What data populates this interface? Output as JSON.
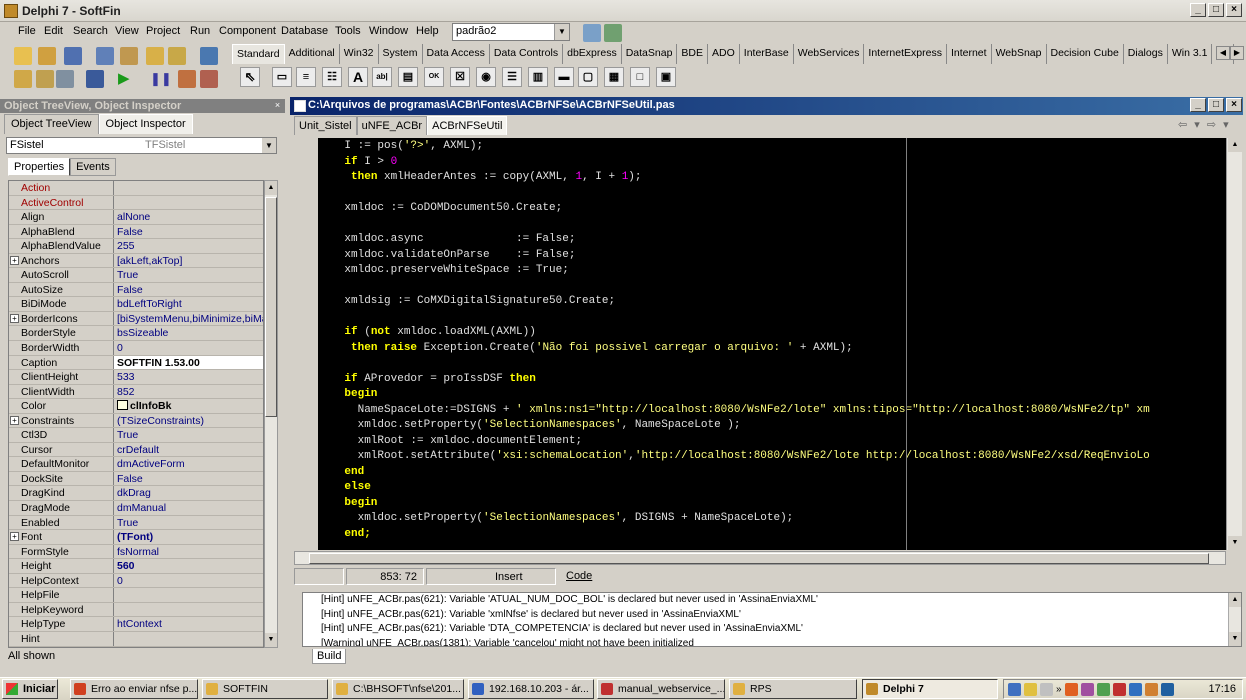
{
  "window": {
    "title": "Delphi 7 - SoftFin"
  },
  "menu": [
    "File",
    "Edit",
    "Search",
    "View",
    "Project",
    "Run",
    "Component",
    "Database",
    "Tools",
    "Window",
    "Help"
  ],
  "desktop_combo": "padrão2",
  "palette_tabs": [
    "Standard",
    "Additional",
    "Win32",
    "System",
    "Data Access",
    "Data Controls",
    "dbExpress",
    "DataSnap",
    "BDE",
    "ADO",
    "InterBase",
    "WebServices",
    "InternetExpress",
    "Internet",
    "WebSnap",
    "Decision Cube",
    "Dialogs",
    "Win 3.1",
    "Sa"
  ],
  "left_panel": {
    "title": "Object TreeView, Object Inspector",
    "tabs": [
      "Object TreeView",
      "Object Inspector"
    ],
    "object_name": "FSistel",
    "object_type": "TFSistel",
    "prop_tabs": [
      "Properties",
      "Events"
    ],
    "properties": [
      {
        "name": "Action",
        "value": "",
        "red": true
      },
      {
        "name": "ActiveControl",
        "value": "",
        "red": true
      },
      {
        "name": "Align",
        "value": "alNone"
      },
      {
        "name": "AlphaBlend",
        "value": "False"
      },
      {
        "name": "AlphaBlendValue",
        "value": "255"
      },
      {
        "name": "Anchors",
        "value": "[akLeft,akTop]",
        "plus": true
      },
      {
        "name": "AutoScroll",
        "value": "True"
      },
      {
        "name": "AutoSize",
        "value": "False"
      },
      {
        "name": "BiDiMode",
        "value": "bdLeftToRight"
      },
      {
        "name": "BorderIcons",
        "value": "[biSystemMenu,biMinimize,biMaxim",
        "plus": true
      },
      {
        "name": "BorderStyle",
        "value": "bsSizeable"
      },
      {
        "name": "BorderWidth",
        "value": "0"
      },
      {
        "name": "Caption",
        "value": "SOFTFIN 1.53.00",
        "selected": true
      },
      {
        "name": "ClientHeight",
        "value": "533"
      },
      {
        "name": "ClientWidth",
        "value": "852"
      },
      {
        "name": "Color",
        "value": "clInfoBk",
        "color": true,
        "bold": true
      },
      {
        "name": "Constraints",
        "value": "(TSizeConstraints)",
        "plus": true
      },
      {
        "name": "Ctl3D",
        "value": "True"
      },
      {
        "name": "Cursor",
        "value": "crDefault"
      },
      {
        "name": "DefaultMonitor",
        "value": "dmActiveForm"
      },
      {
        "name": "DockSite",
        "value": "False"
      },
      {
        "name": "DragKind",
        "value": "dkDrag"
      },
      {
        "name": "DragMode",
        "value": "dmManual"
      },
      {
        "name": "Enabled",
        "value": "True"
      },
      {
        "name": "Font",
        "value": "(TFont)",
        "plus": true,
        "bold": true
      },
      {
        "name": "FormStyle",
        "value": "fsNormal"
      },
      {
        "name": "Height",
        "value": "560",
        "bold": true
      },
      {
        "name": "HelpContext",
        "value": "0"
      },
      {
        "name": "HelpFile",
        "value": ""
      },
      {
        "name": "HelpKeyword",
        "value": ""
      },
      {
        "name": "HelpType",
        "value": "htContext"
      },
      {
        "name": "Hint",
        "value": ""
      }
    ],
    "footer": "All shown"
  },
  "editor": {
    "title": "C:\\Arquivos de programas\\ACBr\\Fontes\\ACBrNFSe\\ACBrNFSeUtil.pas",
    "tabs": [
      "Unit_Sistel",
      "uNFE_ACBr",
      "ACBrNFSeUtil"
    ],
    "code_lines": [
      [
        [
          "id",
          "    I := pos("
        ],
        [
          "str",
          "'?>'"
        ],
        [
          "id",
          ", AXML);"
        ]
      ],
      [
        [
          "id",
          "    "
        ],
        [
          "kw",
          "if"
        ],
        [
          "id",
          " I > "
        ],
        [
          "num",
          "0"
        ]
      ],
      [
        [
          "id",
          "     "
        ],
        [
          "kw",
          "then"
        ],
        [
          "id",
          " xmlHeaderAntes := copy(AXML, "
        ],
        [
          "num",
          "1"
        ],
        [
          "id",
          ", I + "
        ],
        [
          "num",
          "1"
        ],
        [
          "id",
          ");"
        ]
      ],
      [
        [
          "id",
          ""
        ]
      ],
      [
        [
          "id",
          "    xmldoc := CoDOMDocument50.Create;"
        ]
      ],
      [
        [
          "id",
          ""
        ]
      ],
      [
        [
          "id",
          "    xmldoc.async              := False;"
        ]
      ],
      [
        [
          "id",
          "    xmldoc.validateOnParse    := False;"
        ]
      ],
      [
        [
          "id",
          "    xmldoc.preserveWhiteSpace := True;"
        ]
      ],
      [
        [
          "id",
          ""
        ]
      ],
      [
        [
          "id",
          "    xmldsig := CoMXDigitalSignature50.Create;"
        ]
      ],
      [
        [
          "id",
          ""
        ]
      ],
      [
        [
          "id",
          "    "
        ],
        [
          "kw",
          "if"
        ],
        [
          "id",
          " ("
        ],
        [
          "kw",
          "not"
        ],
        [
          "id",
          " xmldoc.loadXML(AXML))"
        ]
      ],
      [
        [
          "id",
          "     "
        ],
        [
          "kw",
          "then raise"
        ],
        [
          "id",
          " Exception.Create("
        ],
        [
          "str",
          "'Não foi possivel carregar o arquivo: '"
        ],
        [
          "id",
          " + AXML);"
        ]
      ],
      [
        [
          "id",
          ""
        ]
      ],
      [
        [
          "id",
          "    "
        ],
        [
          "kw",
          "if"
        ],
        [
          "id",
          " AProvedor = proIssDSF "
        ],
        [
          "kw",
          "then"
        ]
      ],
      [
        [
          "id",
          "    "
        ],
        [
          "kw",
          "begin"
        ]
      ],
      [
        [
          "id",
          "      NameSpaceLote:=DSIGNS + "
        ],
        [
          "str",
          "' xmlns:ns1=\"http://localhost:8080/WsNFe2/lote\" xmlns:tipos=\"http://localhost:8080/WsNFe2/tp\" xm"
        ]
      ],
      [
        [
          "id",
          "      xmldoc.setProperty("
        ],
        [
          "str",
          "'SelectionNamespaces'"
        ],
        [
          "id",
          ", NameSpaceLote );"
        ]
      ],
      [
        [
          "id",
          "      xmlRoot := xmldoc.documentElement;"
        ]
      ],
      [
        [
          "id",
          "      xmlRoot.setAttribute("
        ],
        [
          "str",
          "'xsi:schemaLocation'"
        ],
        [
          "id",
          ","
        ],
        [
          "str",
          "'http://localhost:8080/WsNFe2/lote http://localhost:8080/WsNFe2/xsd/ReqEnvioLo"
        ]
      ],
      [
        [
          "id",
          "    "
        ],
        [
          "kw",
          "end"
        ]
      ],
      [
        [
          "id",
          "    "
        ],
        [
          "kw",
          "else"
        ]
      ],
      [
        [
          "id",
          "    "
        ],
        [
          "kw",
          "begin"
        ]
      ],
      [
        [
          "id",
          "      xmldoc.setProperty("
        ],
        [
          "str",
          "'SelectionNamespaces'"
        ],
        [
          "id",
          ", DSIGNS + NameSpaceLote);"
        ]
      ],
      [
        [
          "id",
          "    "
        ],
        [
          "kw",
          "end;"
        ]
      ]
    ],
    "status": {
      "position": "853:  72",
      "mode": "Insert",
      "tab": "Code"
    }
  },
  "messages": [
    "[Hint] uNFE_ACBr.pas(621): Variable 'ATUAL_NUM_DOC_BOL' is declared but never used in 'AssinaEnviaXML'",
    "[Hint] uNFE_ACBr.pas(621): Variable 'xmlNfse' is declared but never used in 'AssinaEnviaXML'",
    "[Hint] uNFE_ACBr.pas(621): Variable 'DTA_COMPETENCIA' is declared but never used in 'AssinaEnviaXML'",
    "[Warning] uNFE_ACBr.pas(1381): Variable 'cancelou' might not have been initialized"
  ],
  "build_tab": "Build",
  "taskbar": {
    "start": "Iniciar",
    "tasks": [
      {
        "label": "Erro ao enviar nfse p...",
        "color": "#d04020"
      },
      {
        "label": "SOFTFIN",
        "color": "#e0b040"
      },
      {
        "label": "C:\\BHSOFT\\nfse\\201...",
        "color": "#e0b040"
      },
      {
        "label": "192.168.10.203 - ár...",
        "color": "#3060c0"
      },
      {
        "label": "manual_webservice_...",
        "color": "#c03030"
      },
      {
        "label": "RPS",
        "color": "#e0b040"
      },
      {
        "label": "Delphi 7",
        "color": "#c08a2a",
        "active": true
      }
    ],
    "clock": "17:16"
  }
}
